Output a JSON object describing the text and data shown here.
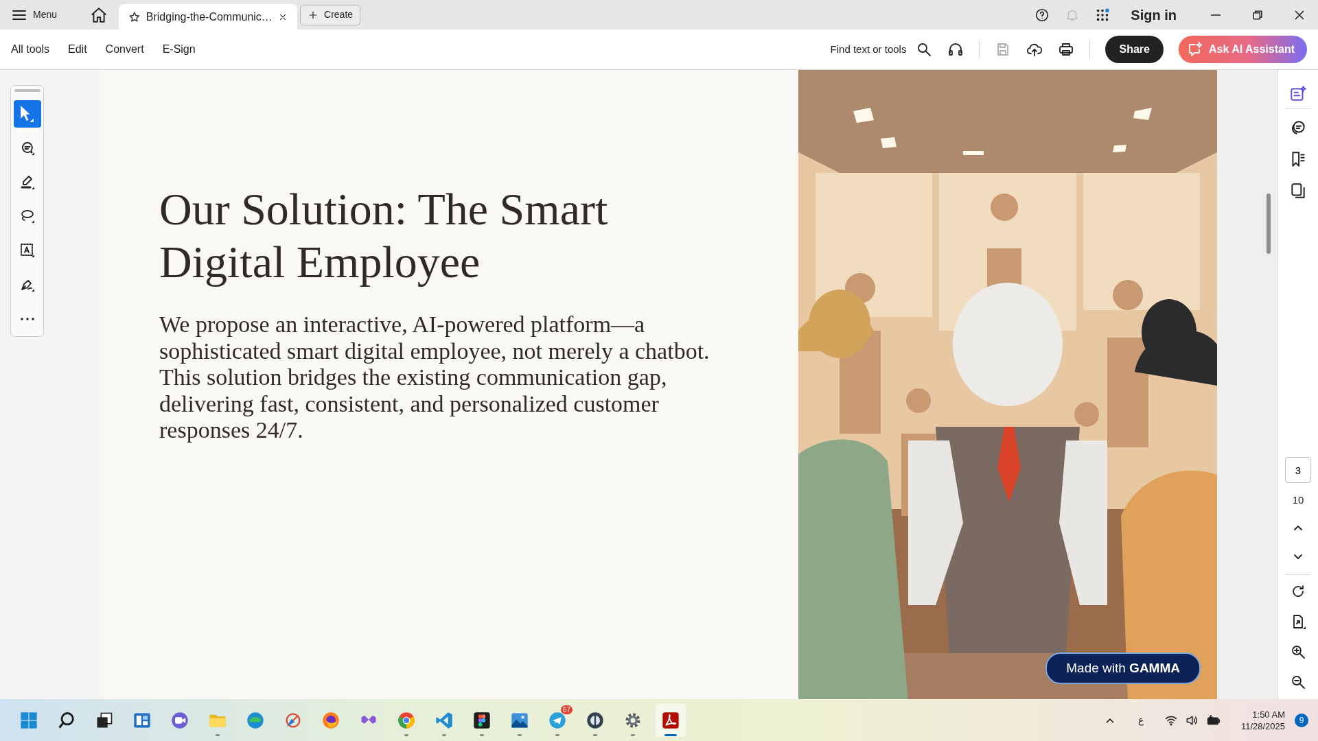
{
  "tab_bar": {
    "menu_label": "Menu",
    "tabs": [
      {
        "title": "Bridging-the-Communic…",
        "selected": true
      }
    ],
    "create_label": "Create",
    "top_icons": [
      {
        "kind": "help",
        "disabled": false
      },
      {
        "kind": "bell",
        "disabled": true
      },
      {
        "kind": "apps",
        "disabled": false
      }
    ],
    "sign_in": "Sign in"
  },
  "toolbar": {
    "menus": [
      "All tools",
      "Edit",
      "Convert",
      "E-Sign"
    ],
    "search_label": "Find text or tools",
    "actions": [
      {
        "kind": "headphones",
        "disabled": false
      },
      {
        "kind": "save",
        "disabled": true
      },
      {
        "kind": "upload",
        "disabled": false
      },
      {
        "kind": "print",
        "disabled": false
      }
    ],
    "share_label": "Share",
    "ai_label": "Ask AI Assistant"
  },
  "left_tools": [
    {
      "kind": "select",
      "selected": true
    },
    {
      "kind": "comment",
      "selected": false
    },
    {
      "kind": "highlight",
      "selected": false
    },
    {
      "kind": "draw",
      "selected": false
    },
    {
      "kind": "text_select",
      "selected": false
    },
    {
      "kind": "sign",
      "selected": false
    },
    {
      "kind": "more",
      "selected": false
    }
  ],
  "slide": {
    "title": "Our Solution: The Smart Digital Employee",
    "body": "We propose an interactive, AI-powered platform—a sophisticated smart digital employee, not merely a chatbot. This solution bridges the existing communication gap, delivering fast, consistent, and personalized customer responses 24/7.",
    "badge": "Made with **GAMMA**"
  },
  "right_panel": {
    "tools": [
      {
        "kind": "ai",
        "selected": true
      },
      {
        "kind": "comments",
        "selected": false
      },
      {
        "kind": "bookmarks",
        "selected": false
      },
      {
        "kind": "pages",
        "selected": false
      }
    ],
    "current_page": "3",
    "total_pages": "10",
    "view_tools": [
      {
        "kind": "rotate"
      },
      {
        "kind": "extract"
      },
      {
        "kind": "zoom_in"
      },
      {
        "kind": "zoom_out"
      }
    ]
  },
  "taskbar": {
    "apps": [
      {
        "kind": "start",
        "running": false,
        "selected": false
      },
      {
        "kind": "search",
        "running": false,
        "selected": false
      },
      {
        "kind": "taskview",
        "running": false,
        "selected": false
      },
      {
        "kind": "widgets",
        "running": false,
        "selected": false
      },
      {
        "kind": "meet",
        "running": false,
        "selected": false
      },
      {
        "kind": "folder",
        "running": true,
        "selected": false
      },
      {
        "kind": "edge",
        "running": false,
        "selected": false
      },
      {
        "kind": "tool",
        "running": false,
        "selected": false
      },
      {
        "kind": "firefox",
        "running": false,
        "selected": false
      },
      {
        "kind": "studio",
        "running": false,
        "selected": false
      },
      {
        "kind": "chrome",
        "running": true,
        "selected": false
      },
      {
        "kind": "vscode",
        "running": true,
        "selected": false
      },
      {
        "kind": "figma",
        "running": true,
        "selected": false
      },
      {
        "kind": "photos",
        "running": true,
        "selected": false
      },
      {
        "kind": "telegram",
        "running": true,
        "selected": false,
        "badge": "67"
      },
      {
        "kind": "disc",
        "running": true,
        "selected": false
      },
      {
        "kind": "settings",
        "running": true,
        "selected": false
      },
      {
        "kind": "acrobat",
        "running": true,
        "selected": true
      }
    ],
    "language": "ع",
    "time": "1:50 AM",
    "date": "11/28/2025",
    "notifications": "9"
  }
}
